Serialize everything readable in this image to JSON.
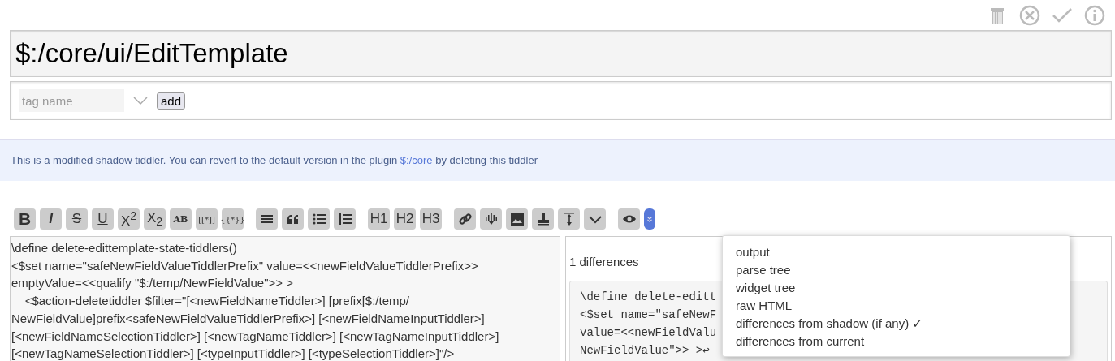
{
  "header_actions": [
    {
      "kind": "delete"
    },
    {
      "kind": "cancel"
    },
    {
      "kind": "done"
    },
    {
      "kind": "info"
    }
  ],
  "title": {
    "value": "$:/core/ui/EditTemplate"
  },
  "tag_input": {
    "placeholder": "tag name",
    "button": "add"
  },
  "notice": {
    "before": "This is a modified shadow tiddler. You can revert to the default version in the plugin ",
    "link": "$:/core",
    "after": " by deleting this tiddler"
  },
  "toolbar": [
    {
      "kind": "text",
      "label": "B"
    },
    {
      "kind": "text",
      "label": "I"
    },
    {
      "kind": "text",
      "label": "S"
    },
    {
      "kind": "text",
      "label": "U"
    },
    {
      "kind": "text",
      "label": "X$^{2}$"
    },
    {
      "kind": "text",
      "label": "X$_{2}$"
    },
    {
      "kind": "text",
      "label": "AB"
    },
    {
      "kind": "text",
      "label": "[[*]]"
    },
    {
      "kind": "text",
      "label": "{{*}}"
    },
    {
      "kind": "icon"
    },
    {
      "kind": "icon"
    },
    {
      "kind": "icon"
    },
    {
      "kind": "icon"
    },
    {
      "kind": "text",
      "label": "H1"
    },
    {
      "kind": "text",
      "label": "H2"
    },
    {
      "kind": "text",
      "label": "H3"
    },
    {
      "kind": "icon"
    },
    {
      "kind": "icon"
    },
    {
      "kind": "icon"
    },
    {
      "kind": "icon"
    },
    {
      "kind": "icon"
    },
    {
      "kind": "icon"
    },
    {
      "kind": "icon"
    },
    {
      "kind": "icon",
      "selected": true
    }
  ],
  "editor": {
    "lines": [
      "\\define delete-edittemplate-state-tiddlers()",
      "<$set name=\"safeNewFieldValueTiddlerPrefix\" value=<<newFieldValueTiddlerPrefix>>",
      "emptyValue=<<qualify \"$:/temp/NewFieldValue\">> >",
      "    <$action-deletetiddler $filter=\"[<newFieldNameTiddler>] [prefix[$:/temp/",
      "NewFieldValue]prefix<safeNewFieldValueTiddlerPrefix>] [<newFieldNameInputTiddler>]",
      "[<newFieldNameSelectionTiddler>] [<newTagNameTiddler>] [<newTagNameInputTiddler>]",
      "[<newTagNameSelectionTiddler>] [<typeInputTiddler>] [<typeSelectionTiddler>]\"/>"
    ]
  },
  "preview": {
    "summary": "1 differences",
    "code_lines": [
      "\\define delete-editt",
      "<$set name=\"safeNewF",
      "value=<<newFieldValu",
      "NewFieldValue\">> >↩"
    ]
  },
  "preview_menu": [
    {
      "label": "output"
    },
    {
      "label": "parse tree"
    },
    {
      "label": "widget tree"
    },
    {
      "label": "raw HTML"
    },
    {
      "label": "differences from shadow (if any) ✓"
    },
    {
      "label": "differences from current"
    }
  ]
}
